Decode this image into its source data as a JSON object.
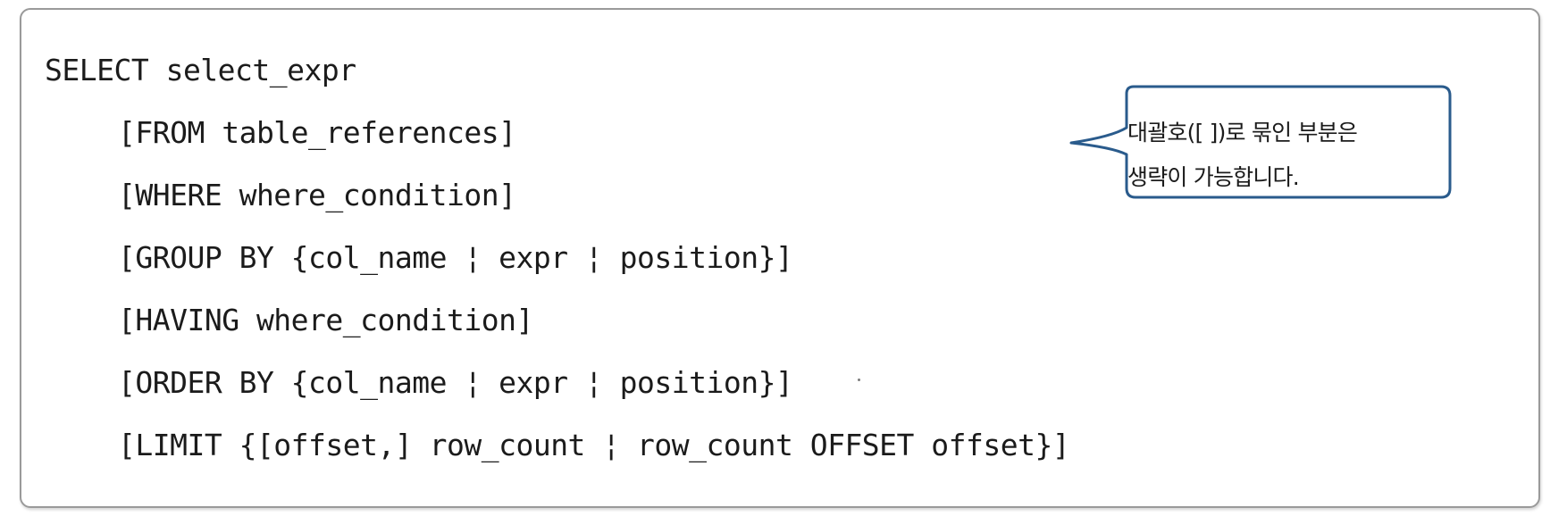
{
  "syntax": {
    "lines": [
      "SELECT select_expr",
      "[FROM table_references]",
      "[WHERE where_condition]",
      "[GROUP BY {col_name ¦ expr ¦ position}]",
      "[HAVING where_condition]",
      "[ORDER BY {col_name ¦ expr ¦ position}]",
      "[LIMIT {[offset,] row_count ¦ row_count OFFSET offset}]"
    ]
  },
  "callout": {
    "line1": "대괄호([ ])로 묶인 부분은",
    "line2": "생략이 가능합니다.",
    "border_color": "#2a5b8c"
  }
}
